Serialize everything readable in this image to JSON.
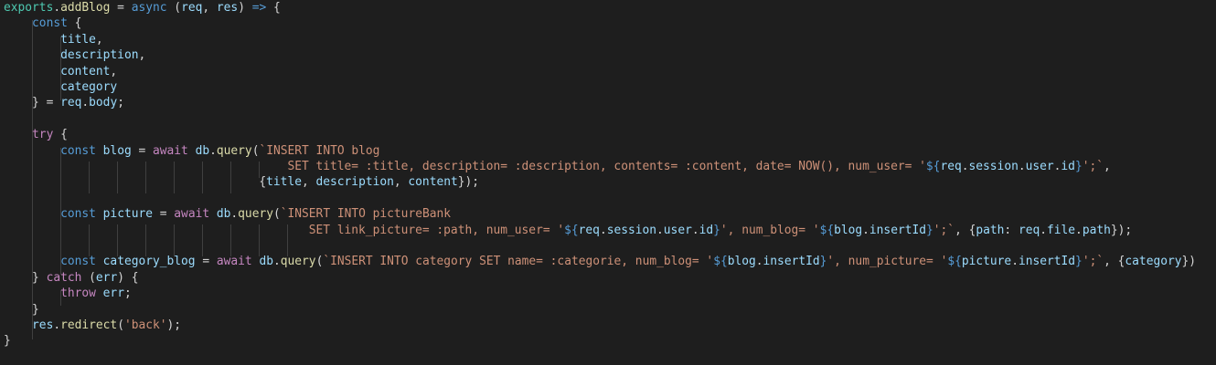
{
  "code": {
    "exports": "exports",
    "addBlog": "addBlog",
    "async": "async",
    "req": "req",
    "res": "res",
    "arrow": "=>",
    "const": "const",
    "title": "title",
    "description": "description",
    "content": "content",
    "category": "category",
    "body": "body",
    "try": "try",
    "blog": "blog",
    "await": "await",
    "db": "db",
    "query": "query",
    "q1_line1": "`INSERT INTO blog",
    "q1_line2": "SET title= :title, description= :description, contents= :content, date= NOW(), num_user= '",
    "session": "session",
    "user": "user",
    "id": "id",
    "tick_end": "';`",
    "picture": "picture",
    "q2_line1": "`INSERT INTO pictureBank",
    "q2_line2": "SET link_picture= :path, num_user= '",
    "q2_mid": "', num_blog= '",
    "insertId": "insertId",
    "path": "path",
    "file": "file",
    "category_blog": "category_blog",
    "q3_line1": "`INSERT INTO category SET name= :categorie, num_blog= '",
    "q3_mid": "', num_picture= '",
    "catch": "catch",
    "err": "err",
    "throw": "throw",
    "redirect": "redirect",
    "back": "'back'"
  },
  "colors": {
    "background": "#1e1e1e",
    "keyword": "#569cd6",
    "control": "#c586c0",
    "variable": "#9cdcfe",
    "function": "#dcdcaa",
    "string": "#ce9178"
  }
}
